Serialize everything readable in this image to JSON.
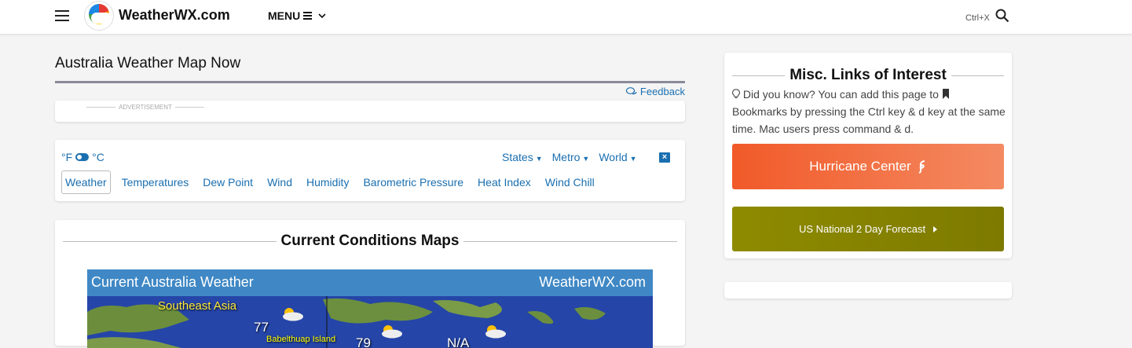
{
  "header": {
    "site_name": "WeatherWX.com",
    "menu_label": "MENU",
    "shortcut_hint": "Ctrl+X"
  },
  "main": {
    "page_title": "Australia Weather Map Now",
    "feedback_label": "Feedback",
    "ad_label": "ADVERTISEMENT",
    "units": {
      "f": "°F",
      "c": "°C"
    },
    "regions": [
      "States",
      "Metro",
      "World"
    ],
    "close_label": "×",
    "tabs": [
      {
        "label": "Weather",
        "active": true
      },
      {
        "label": "Temperatures"
      },
      {
        "label": "Dew Point"
      },
      {
        "label": "Wind"
      },
      {
        "label": "Humidity"
      },
      {
        "label": "Barometric Pressure"
      },
      {
        "label": "Heat Index"
      },
      {
        "label": "Wind Chill"
      }
    ],
    "section_title": "Current Conditions Maps",
    "map": {
      "title": "Current Australia Weather",
      "brand": "WeatherWX.com",
      "labels": {
        "region": "Southeast Asia",
        "temp1": "77",
        "temp2": "79",
        "temp3": "N/A",
        "place": "Babelthuap Island"
      }
    }
  },
  "sidebar": {
    "title": "Misc. Links of Interest",
    "tip": "Did you know? You can add this page to",
    "tip_rest": "Bookmarks by pressing the Ctrl key & d key at the same time. Mac users press command & d.",
    "hurricane_label": "Hurricane Center",
    "forecast_label": "US National 2 Day Forecast"
  },
  "colors": {
    "link": "#1a6fb0",
    "hurricane": "#f15a29",
    "forecast": "#8e8b00",
    "map_header": "#3f88c5",
    "ocean": "#2545a8"
  },
  "icons": [
    "hamburger-icon",
    "logo-icon",
    "menu-bars-icon",
    "chevron-down-icon",
    "search-icon",
    "comments-icon",
    "toggle-icon",
    "close-icon",
    "lightbulb-icon",
    "bookmark-icon",
    "hurricane-icon",
    "caret-right-icon",
    "cloud-sun-icon"
  ]
}
